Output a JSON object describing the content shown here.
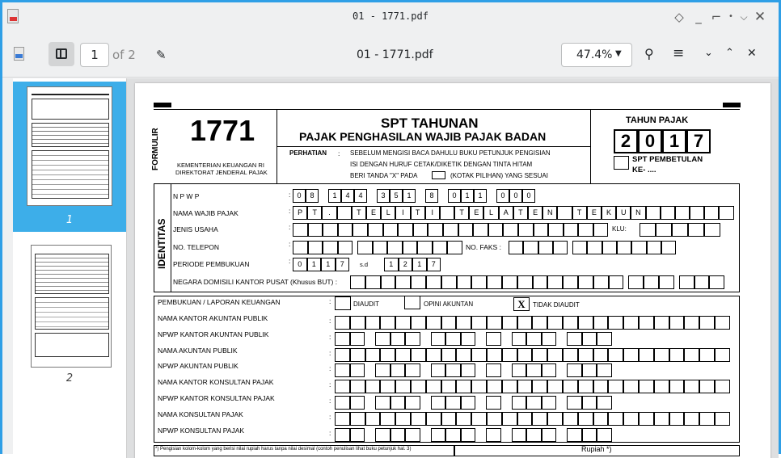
{
  "window": {
    "title": "01 - 1771.pdf"
  },
  "toolbar": {
    "page_number": "1",
    "page_total": "of 2",
    "doc_title": "01 - 1771.pdf",
    "zoom": "47.4%"
  },
  "sidebar": {
    "pages": [
      {
        "label": "1"
      },
      {
        "label": "2"
      }
    ]
  },
  "form": {
    "formulir": "FORMULIR",
    "number": "1771",
    "ministry": "KEMENTERIAN KEUANGAN RI",
    "directorate": "DIREKTORAT JENDERAL PAJAK",
    "title1": "SPT TAHUNAN",
    "title2": "PAJAK PENGHASILAN WAJIB PAJAK BADAN",
    "perhatian": "PERHATIAN",
    "colon": ":",
    "note1": "SEBELUM MENGISI BACA DAHULU BUKU PETUNJUK PENGISIAN",
    "note2": "ISI DENGAN HURUF CETAK/DIKETIK DENGAN TINTA HITAM",
    "note3a": "BERI TANDA \"X\" PADA",
    "note3b": "(KOTAK PILIHAN) YANG SESUAI",
    "tahun_pajak": "TAHUN PAJAK",
    "year_digits": [
      "2",
      "0",
      "1",
      "7"
    ],
    "pembetulan1": "SPT PEMBETULAN",
    "pembetulan2": "KE- ....",
    "identitas": "IDENTITAS",
    "npwp_label": "N P W P",
    "npwp_digits": [
      "0",
      "8",
      "",
      "1",
      "4",
      "4",
      "",
      "3",
      "5",
      "1",
      "",
      "8",
      "",
      "0",
      "1",
      "1",
      "",
      "0",
      "0",
      "0"
    ],
    "nama_label": "NAMA WAJIB PAJAK",
    "nama_chars": [
      "P",
      "T",
      ".",
      "",
      "T",
      "E",
      "L",
      "I",
      "T",
      "I",
      "",
      "T",
      "E",
      "L",
      "A",
      "T",
      "E",
      "N",
      "",
      "T",
      "E",
      "K",
      "U",
      "N",
      "",
      "",
      "",
      "",
      "",
      ""
    ],
    "jenis_label": "JENIS USAHA",
    "klu_label": "KLU:",
    "telepon_label": "NO. TELEPON",
    "faks_label": "NO. FAKS :",
    "periode_label": "PERIODE PEMBUKUAN",
    "periode_start": [
      "0",
      "1",
      "1",
      "7"
    ],
    "sd": "s.d",
    "periode_end": [
      "1",
      "2",
      "1",
      "7"
    ],
    "negara_label": "NEGARA DOMISILI KANTOR PUSAT (Khusus BUT) :",
    "pembukuan_label": "PEMBUKUAN / LAPORAN KEUANGAN",
    "diaudit": "DIAUDIT",
    "opini": "OPINI AKUNTAN",
    "tidak_diaudit": "TIDAK DIAUDIT",
    "x_mark": "X",
    "rows": [
      "NAMA KANTOR AKUNTAN PUBLIK",
      "NPWP KANTOR AKUNTAN PUBLIK",
      "NAMA AKUNTAN PUBLIK",
      "NPWP AKUNTAN PUBLIK",
      "NAMA KANTOR KONSULTAN PAJAK",
      "NPWP KANTOR KONSULTAN PAJAK",
      "NAMA KONSULTAN PAJAK",
      "NPWP KONSULTAN PAJAK"
    ],
    "footnote": "*) Pengisian kolom-kolom yang berisi nilai rupiah harus tanpa nilai desimal (contoh penulisan lihat buku petunjuk hal. 3)",
    "rupiah": "Rupiah *)"
  }
}
